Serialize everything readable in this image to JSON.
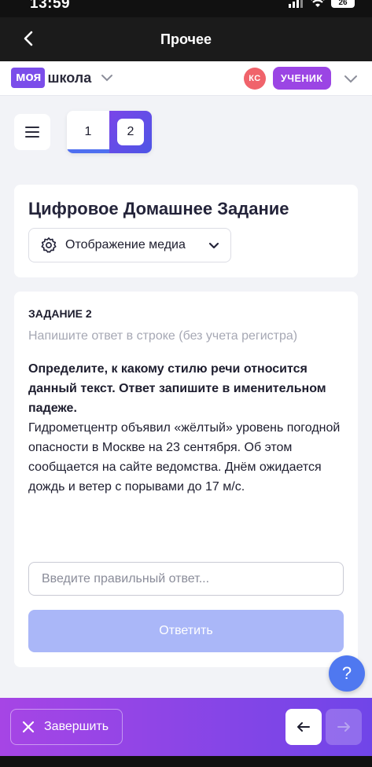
{
  "status_bar": {
    "time": "13:59",
    "battery": "26"
  },
  "nav": {
    "title": "Прочее"
  },
  "header": {
    "logo_part1": "моя",
    "logo_part2": "школа",
    "avatar_initials": "КС",
    "role": "УЧЕНИК"
  },
  "pager": {
    "pages": [
      "1",
      "2"
    ],
    "current": "2"
  },
  "assignment": {
    "title": "Цифровое Домашнее Задание",
    "media_select_label": "Отображение медиа"
  },
  "task": {
    "number_label": "ЗАДАНИЕ 2",
    "hint": "Напишите ответ в строке (без учета регистра)",
    "question": "Определите, к какому стилю речи относится данный текст. Ответ запишите в именительном падеже.",
    "text": "Гидрометцентр объявил «жёлтый» уровень погодной опасности в Москве на 23 сентября. Об этом сообщается на сайте ведомства. Днём ожидается дождь и ветер с порывами до 17 м/с.",
    "answer_placeholder": "Введите правильный ответ...",
    "submit_label": "Ответить"
  },
  "help": {
    "label": "?"
  },
  "bottom_bar": {
    "finish_label": "Завершить"
  },
  "colors": {
    "brand": "#7b4dea",
    "role_badge": "#9b45e4",
    "avatar": "#f0636b",
    "submit_disabled": "#aab7f8",
    "help_button": "#4f78f0",
    "page_indicator": "#4f6ff0"
  },
  "icons": {
    "back": "chevron-left-icon",
    "menu": "hamburger-icon",
    "media": "gear-icon",
    "dropdown": "chevron-down-icon",
    "finish": "close-icon",
    "prev": "arrow-left-icon",
    "next": "arrow-right-icon"
  }
}
